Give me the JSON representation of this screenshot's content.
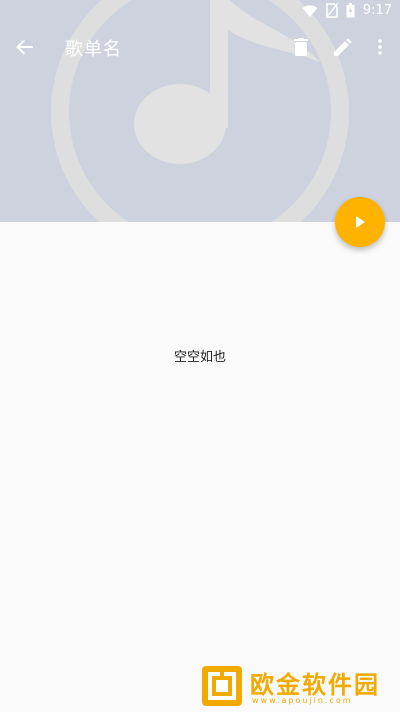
{
  "status_bar": {
    "time": "9:17",
    "icons": [
      "wifi-icon",
      "no-sim-icon",
      "battery-icon"
    ]
  },
  "toolbar": {
    "title": "歌单名",
    "actions": [
      "back-arrow-icon",
      "delete-icon",
      "edit-icon",
      "more-vert-icon"
    ]
  },
  "header": {
    "background_color": "#cdd2de",
    "art_icon": "music-note-icon"
  },
  "fab": {
    "icon": "play-icon",
    "color": "#ffb300"
  },
  "content": {
    "empty_text": "空空如也"
  },
  "watermark": {
    "brand": "欧金软件园",
    "url": "www.apoujin.com"
  }
}
